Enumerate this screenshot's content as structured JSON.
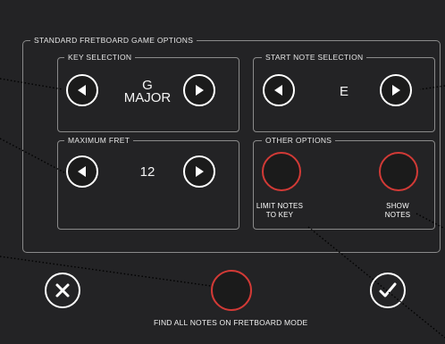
{
  "panel": {
    "title": "STANDARD FRETBOARD GAME OPTIONS"
  },
  "key_selection": {
    "title": "KEY SELECTION",
    "key": "G",
    "mode": "MAJOR",
    "prev_icon": "triangle-left-icon",
    "next_icon": "triangle-right-icon"
  },
  "start_note": {
    "title": "START NOTE SELECTION",
    "value": "E"
  },
  "max_fret": {
    "title": "MAXIMUM FRET",
    "value": "12"
  },
  "other_options": {
    "title": "OTHER OPTIONS",
    "limit_notes_line1": "LIMIT NOTES",
    "limit_notes_line2": "TO KEY",
    "show_notes_line1": "SHOW",
    "show_notes_line2": "NOTES"
  },
  "bottom": {
    "find_all_label": "FIND ALL NOTES ON FRETBOARD MODE",
    "cancel_icon": "close-icon",
    "confirm_icon": "checkmark-icon"
  },
  "colors": {
    "background": "#232325",
    "toggle_off_ring": "#d23a36",
    "border": "#8a8a8a"
  }
}
